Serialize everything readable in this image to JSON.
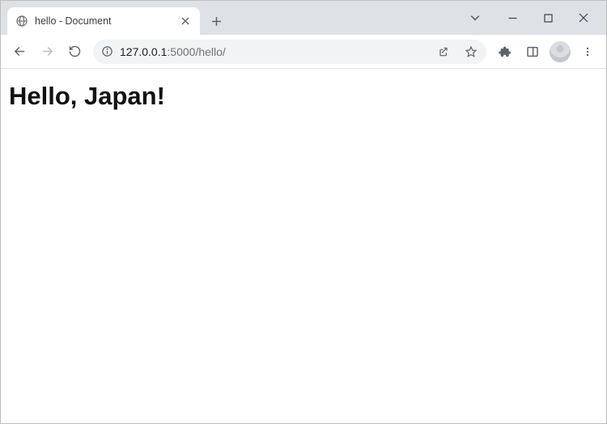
{
  "tab": {
    "title": "hello - Document"
  },
  "toolbar": {
    "url_host": "127.0.0.1",
    "url_port": ":5000",
    "url_path": "/hello/"
  },
  "page": {
    "heading": "Hello, Japan!"
  }
}
